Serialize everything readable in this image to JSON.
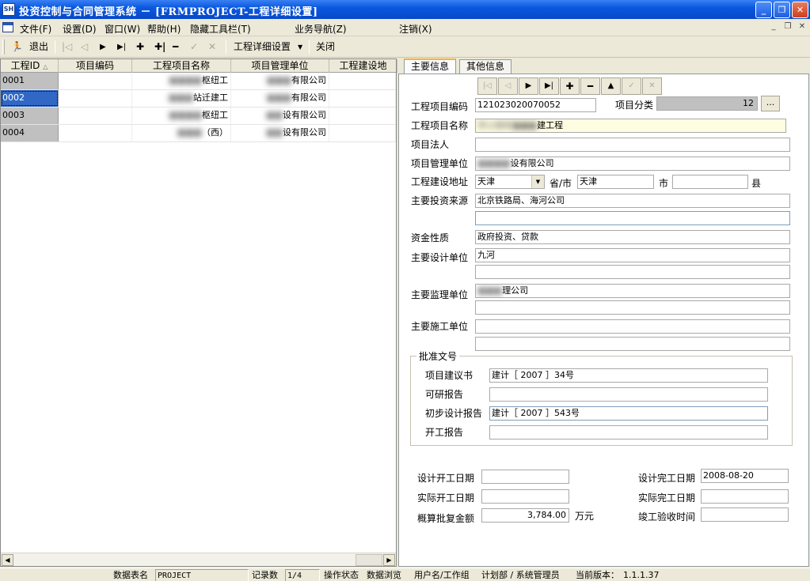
{
  "window": {
    "title": "投资控制与合同管理系统 － [FRMPROJECT-工程详细设置]",
    "icon_text": "SH"
  },
  "menu": {
    "items": [
      "文件(F)",
      "设置(D)",
      "窗口(W)",
      "帮助(H)",
      "隐藏工具栏(T)",
      "业务导航(Z)",
      "注销(X)"
    ]
  },
  "toolbar": {
    "exit_label": "退出",
    "detail_settings_label": "工程详细设置",
    "close_label": "关闭"
  },
  "grid": {
    "columns": [
      "工程ID",
      "项目编码",
      "工程项目名称",
      "项目管理单位",
      "工程建设地"
    ],
    "rows": [
      {
        "id": "0001",
        "code": "",
        "name": "枢纽工",
        "unit": "有限公司"
      },
      {
        "id": "0002",
        "code": "",
        "name": "站迁建工",
        "unit": "有限公司"
      },
      {
        "id": "0003",
        "code": "",
        "name": "枢纽工",
        "unit": "设有限公司"
      },
      {
        "id": "0004",
        "code": "",
        "name": "（西）",
        "unit": "设有限公司"
      }
    ]
  },
  "tabs": [
    "主要信息",
    "其他信息"
  ],
  "form": {
    "code_label": "工程项目编码",
    "code_value": "121023020070052",
    "category_label": "项目分类",
    "category_value": "12",
    "ellipsis": "...",
    "name_label": "工程项目名称",
    "name_value": "李公楼闸",
    "name_value_tail": "建工程",
    "legal_label": "项目法人",
    "legal_value": "",
    "mgmt_label": "项目管理单位",
    "mgmt_value": "设有限公司",
    "addr_label": "工程建设地址",
    "province_value": "天津",
    "province_suffix": "省/市",
    "city_value": "天津",
    "city_suffix": "市",
    "county_value": "",
    "county_suffix": "县",
    "invest_label": "主要投资来源",
    "invest_value": "北京铁路局、海河公司",
    "invest_value2": "",
    "fund_label": "资金性质",
    "fund_value": "政府投资、贷款",
    "design_label": "主要设计单位",
    "design_value": "九河",
    "design_value2": "",
    "supervise_label": "主要监理单位",
    "supervise_value": "理公司",
    "supervise_value2": "",
    "construct_label": "主要施工单位",
    "construct_value": "",
    "construct_value2": "",
    "approval_group": "批准文号",
    "proposal_label": "项目建议书",
    "proposal_value": "建计［ 2007 ］34号",
    "feasibility_label": "可研报告",
    "feasibility_value": "",
    "prelim_label": "初步设计报告",
    "prelim_value": "建计［ 2007 ］543号",
    "start_report_label": "开工报告",
    "start_report_value": "",
    "design_start_label": "设计开工日期",
    "design_start_value": "",
    "design_end_label": "设计完工日期",
    "design_end_value": "2008-08-20",
    "actual_start_label": "实际开工日期",
    "actual_start_value": "",
    "actual_end_label": "实际完工日期",
    "actual_end_value": "",
    "budget_label": "概算批复金额",
    "budget_value": "3,784.00",
    "budget_unit": "万元",
    "acceptance_label": "竣工验收时间",
    "acceptance_value": ""
  },
  "status": {
    "table_label": "数据表名",
    "table_value": "PROJECT",
    "records_label": "记录数",
    "records_value": "1/4",
    "op_label": "操作状态",
    "op_value": "数据浏览",
    "user_label": "用户名/工作组",
    "user_value": "计划部 / 系统管理员",
    "version_label": "当前版本：",
    "version_value": "1.1.1.37"
  }
}
